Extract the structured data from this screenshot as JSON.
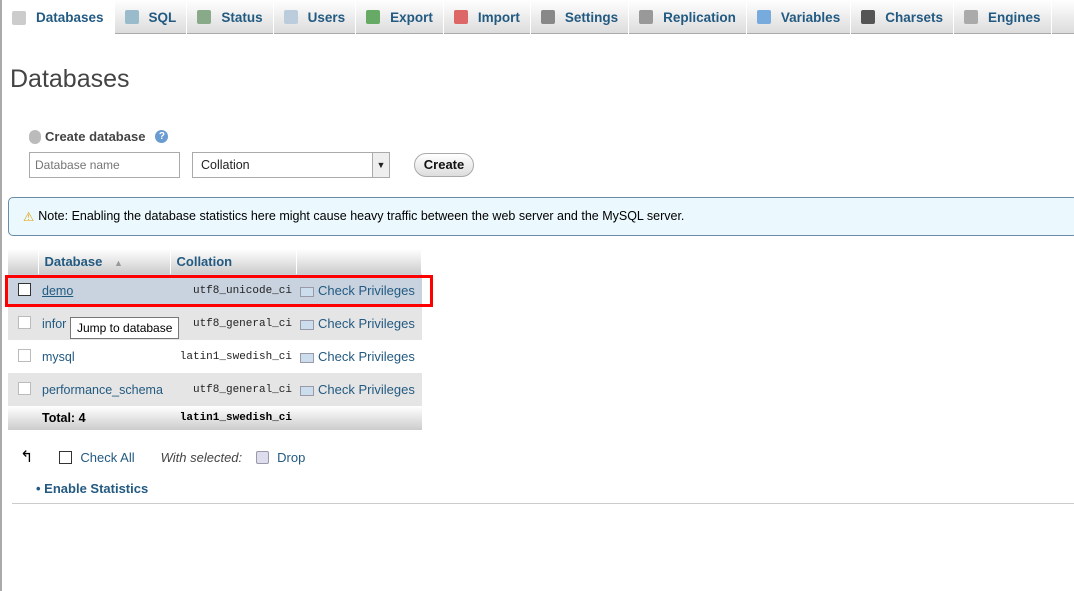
{
  "tabs": [
    {
      "label": "Databases",
      "icon": "database-icon",
      "active": true
    },
    {
      "label": "SQL",
      "icon": "sql-icon"
    },
    {
      "label": "Status",
      "icon": "status-icon"
    },
    {
      "label": "Users",
      "icon": "users-icon"
    },
    {
      "label": "Export",
      "icon": "export-icon"
    },
    {
      "label": "Import",
      "icon": "import-icon"
    },
    {
      "label": "Settings",
      "icon": "wrench-icon"
    },
    {
      "label": "Replication",
      "icon": "replication-icon"
    },
    {
      "label": "Variables",
      "icon": "variables-icon"
    },
    {
      "label": "Charsets",
      "icon": "charsets-icon"
    },
    {
      "label": "Engines",
      "icon": "engines-icon"
    }
  ],
  "page_title": "Databases",
  "create": {
    "label": "Create database",
    "name_placeholder": "Database name",
    "collation": "Collation",
    "button": "Create"
  },
  "note": "Note: Enabling the database statistics here might cause heavy traffic between the web server and the MySQL server.",
  "table": {
    "headers": [
      "Database",
      "Collation"
    ],
    "rows": [
      {
        "name": "demo",
        "collation": "utf8_unicode_ci",
        "action": "Check Privileges"
      },
      {
        "name": "information_schema",
        "display": "infor",
        "collation": "utf8_general_ci",
        "action": "Check Privileges"
      },
      {
        "name": "mysql",
        "collation": "latin1_swedish_ci",
        "action": "Check Privileges"
      },
      {
        "name": "performance_schema",
        "collation": "utf8_general_ci",
        "action": "Check Privileges"
      }
    ],
    "total_label": "Total: 4",
    "total_collation": "latin1_swedish_ci"
  },
  "tooltip": "Jump to database",
  "bottom": {
    "check_all": "Check All",
    "with_selected": "With selected:",
    "drop": "Drop"
  },
  "enable_stats": "Enable Statistics"
}
